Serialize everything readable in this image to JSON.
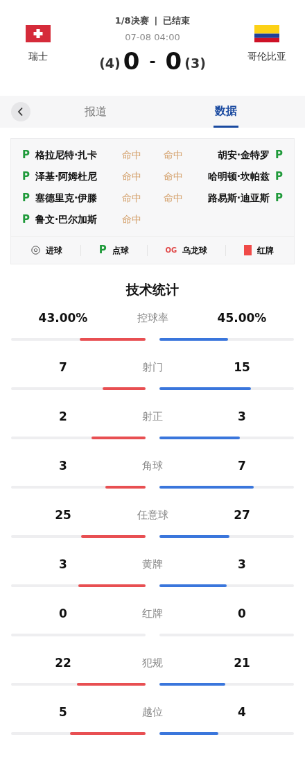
{
  "match": {
    "round": "1/8决赛",
    "divider": "|",
    "status": "已结束",
    "time": "07-08 04:00",
    "home": {
      "name": "瑞士",
      "score": "0",
      "penalties": "(4)"
    },
    "away": {
      "name": "哥伦比亚",
      "score": "0",
      "penalties": "(3)"
    },
    "separator": "-"
  },
  "tabs": [
    {
      "label": "报道",
      "selected": false
    },
    {
      "label": "数据",
      "selected": true
    }
  ],
  "shootout": {
    "home": [
      {
        "kind": "penalty",
        "mark": "P",
        "player": "格拉尼特·扎卡",
        "result": "命中"
      },
      {
        "kind": "penalty",
        "mark": "P",
        "player": "泽基·阿姆杜尼",
        "result": "命中"
      },
      {
        "kind": "penalty",
        "mark": "P",
        "player": "塞德里克·伊滕",
        "result": "命中"
      },
      {
        "kind": "penalty",
        "mark": "P",
        "player": "鲁文·巴尔加斯",
        "result": "命中"
      }
    ],
    "away": [
      {
        "kind": "penalty",
        "mark": "P",
        "player": "胡安·金特罗",
        "result": "命中"
      },
      {
        "kind": "penalty",
        "mark": "P",
        "player": "哈明顿·坎帕兹",
        "result": "命中"
      },
      {
        "kind": "penalty",
        "mark": "P",
        "player": "路易斯·迪亚斯",
        "result": "命中"
      }
    ]
  },
  "legend": [
    {
      "kind": "goal",
      "label": "进球"
    },
    {
      "kind": "penalty",
      "mark": "P",
      "label": "点球"
    },
    {
      "kind": "own_goal",
      "mark": "OG",
      "label": "乌龙球"
    },
    {
      "kind": "red_card",
      "label": "红牌"
    }
  ],
  "stats_title": "技术统计",
  "stats": [
    {
      "name": "控球率",
      "home": {
        "value": "43.00%",
        "level": 0.49
      },
      "away": {
        "value": "45.00%",
        "level": 0.51
      }
    },
    {
      "name": "射门",
      "home": {
        "value": "7",
        "level": 0.32
      },
      "away": {
        "value": "15",
        "level": 0.68
      }
    },
    {
      "name": "射正",
      "home": {
        "value": "2",
        "level": 0.4
      },
      "away": {
        "value": "3",
        "level": 0.6
      }
    },
    {
      "name": "角球",
      "home": {
        "value": "3",
        "level": 0.3
      },
      "away": {
        "value": "7",
        "level": 0.7
      }
    },
    {
      "name": "任意球",
      "home": {
        "value": "25",
        "level": 0.48
      },
      "away": {
        "value": "27",
        "level": 0.52
      }
    },
    {
      "name": "黄牌",
      "home": {
        "value": "3",
        "level": 0.5
      },
      "away": {
        "value": "3",
        "level": 0.5
      }
    },
    {
      "name": "红牌",
      "home": {
        "value": "0",
        "level": 0
      },
      "away": {
        "value": "0",
        "level": 0
      }
    },
    {
      "name": "犯规",
      "home": {
        "value": "22",
        "level": 0.51
      },
      "away": {
        "value": "21",
        "level": 0.49
      }
    },
    {
      "name": "越位",
      "home": {
        "value": "5",
        "level": 0.56
      },
      "away": {
        "value": "4",
        "level": 0.44
      }
    }
  ]
}
